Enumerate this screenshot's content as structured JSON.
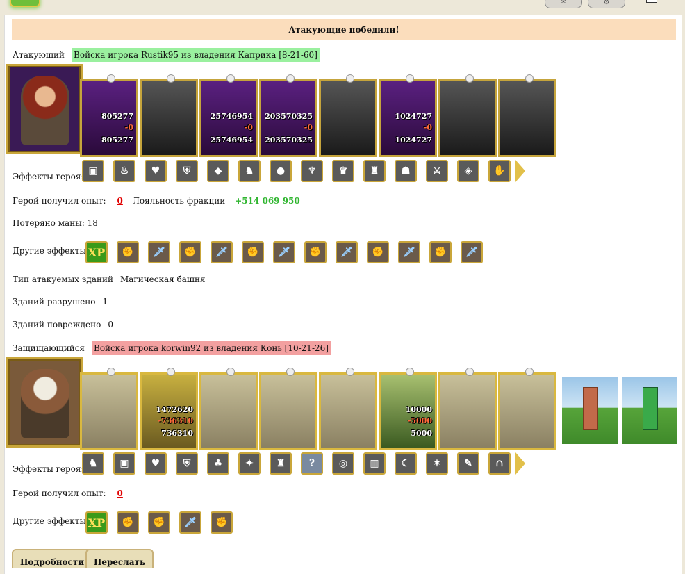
{
  "banner": "Атакующие победили!",
  "attacker": {
    "role_label": "Атакующий",
    "army_label": "Войска игрока Rustik95 из владения Каприка [8-21-60]",
    "hero_name": "attacker-hero",
    "units": [
      {
        "name": "unit-gnome-warrior",
        "top": "805277",
        "mid": "-0",
        "bot": "805277"
      },
      {
        "name": "unit-skeleton",
        "top": "",
        "mid": "",
        "bot": ""
      },
      {
        "name": "unit-dark-knight",
        "top": "25746954",
        "mid": "-0",
        "bot": "25746954"
      },
      {
        "name": "unit-bone-dragon",
        "top": "203570325",
        "mid": "-0",
        "bot": "203570325"
      },
      {
        "name": "unit-black-knight",
        "top": "",
        "mid": "",
        "bot": ""
      },
      {
        "name": "unit-lich",
        "top": "1024727",
        "mid": "-0",
        "bot": "1024727"
      },
      {
        "name": "unit-reaper",
        "top": "",
        "mid": "",
        "bot": ""
      },
      {
        "name": "unit-ghost",
        "top": "",
        "mid": "",
        "bot": ""
      }
    ],
    "hero_effects_label": "Эффекты героя:",
    "hero_effects": [
      "chest-icon",
      "fire-chest-icon",
      "heart-icon",
      "shield-icon",
      "gold-icon",
      "knight-icon",
      "orb-icon",
      "torch-icon",
      "crown-icon",
      "castle-icon",
      "helmet-icon",
      "spears-icon",
      "gem-icon",
      "gauntlet-icon"
    ],
    "exp_label": "Герой получил опыт:",
    "exp_value": "0",
    "loyalty_label": "Лояльность фракции",
    "loyalty_value": "+514 069 950",
    "mana_label": "Потеряно маны: 18",
    "other_effects_label": "Другие эффекты:",
    "other_effects": [
      "xp",
      "fist",
      "sword",
      "fist",
      "sword",
      "fist",
      "sword",
      "fist",
      "sword",
      "fist",
      "sword",
      "fist",
      "sword"
    ],
    "xp_text": "XP",
    "building_type_label": "Тип атакуемых зданий",
    "building_type_value": "Магическая башня",
    "destroyed_label": "Зданий разрушено",
    "destroyed_value": "1",
    "damaged_label": "Зданий повреждено",
    "damaged_value": "0"
  },
  "defender": {
    "role_label": "Защищающийся",
    "army_label": "Войска игрока korwin92 из владения Конь [10-21-26]",
    "units": [
      {
        "name": "unit-mounted-knight",
        "top": "",
        "mid": "",
        "bot": "",
        "style": "def"
      },
      {
        "name": "unit-golden-angel",
        "top": "1472620",
        "mid": "-736310",
        "bot": "736310",
        "style": "defgold"
      },
      {
        "name": "unit-cavalry",
        "top": "",
        "mid": "",
        "bot": "",
        "style": "def"
      },
      {
        "name": "unit-griffin",
        "top": "",
        "mid": "",
        "bot": "",
        "style": "def"
      },
      {
        "name": "unit-archer",
        "top": "",
        "mid": "",
        "bot": "",
        "style": "def"
      },
      {
        "name": "unit-mage",
        "top": "10000",
        "mid": "-5000",
        "bot": "5000",
        "style": "defgreen"
      },
      {
        "name": "unit-warlord",
        "top": "",
        "mid": "",
        "bot": "",
        "style": "def"
      },
      {
        "name": "unit-wizard",
        "top": "",
        "mid": "",
        "bot": "",
        "style": "def"
      }
    ],
    "hero_effects_label": "Эффекты героя:",
    "hero_effects": [
      "knight-icon",
      "chest-icon",
      "heart-icon",
      "shield-icon",
      "tree-icon",
      "crystal-icon",
      "castle-icon",
      "question-icon",
      "ring-icon",
      "gate-icon",
      "scythe-icon",
      "claw-icon",
      "scroll-icon",
      "arch-icon"
    ],
    "question_text": "?",
    "exp_label": "Герой получил опыт:",
    "exp_value": "0",
    "other_effects_label": "Другие эффекты:",
    "other_effects": [
      "xp",
      "fist",
      "fist",
      "sword",
      "fist"
    ],
    "xp_text": "XP"
  },
  "buttons": {
    "details": "Подробности",
    "forward": "Переслать"
  }
}
